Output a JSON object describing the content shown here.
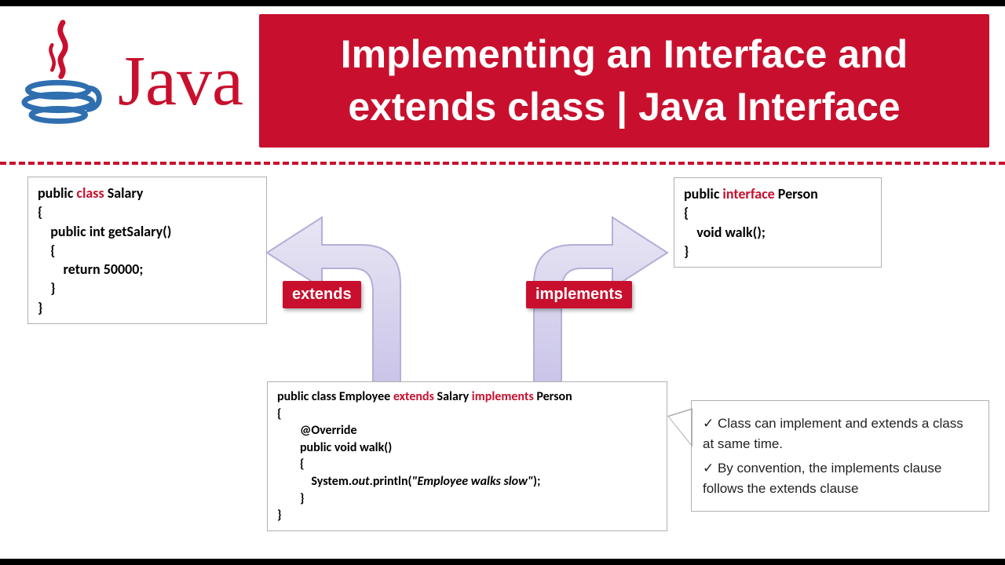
{
  "header": {
    "logo_text": "Java",
    "title": "Implementing an Interface and extends class | Java Interface"
  },
  "salary": {
    "l1a": "public ",
    "l1b": "class",
    "l1c": " Salary",
    "l2": "{",
    "l3": "    public int getSalary()",
    "l4": "    {",
    "l5": "        return 50000;",
    "l6": "    }",
    "l7": "}"
  },
  "person": {
    "l1a": "public ",
    "l1b": "interface",
    "l1c": " Person",
    "l2": "{",
    "l3": "    void walk();",
    "l4": "}"
  },
  "employee": {
    "l1a": "public class Employee ",
    "l1b": "extends",
    "l1c": " Salary ",
    "l1d": "implements",
    "l1e": " Person",
    "l2": "{",
    "l3": "        @Override",
    "l4": "        public void walk()",
    "l5": "        {",
    "l6a": "            System.",
    "l6b": "out",
    "l6c": ".println(",
    "l6d": "\"Employee walks slow\"",
    "l6e": ");",
    "l7": "        }",
    "l8": "}"
  },
  "labels": {
    "extends": "extends",
    "implements": "implements"
  },
  "info": {
    "point1": "Class can implement and extends a class at same time.",
    "point2": "By convention, the implements clause follows the extends clause"
  }
}
